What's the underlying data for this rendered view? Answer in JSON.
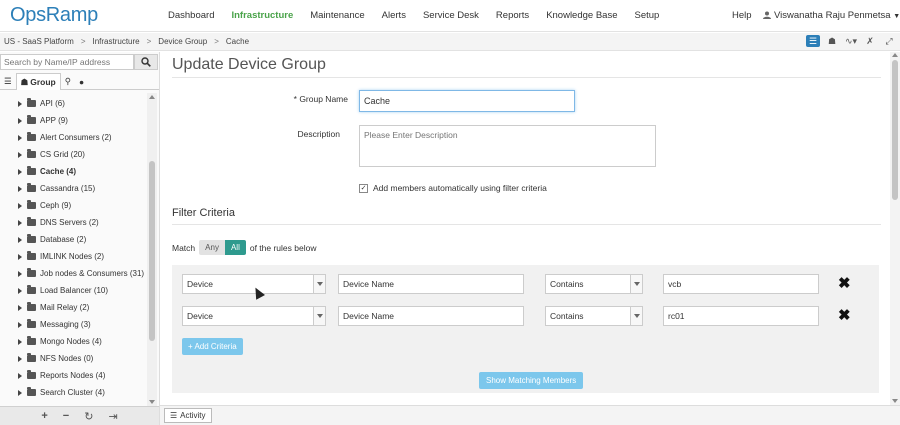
{
  "app": {
    "logo": "OpsRamp",
    "brand_color": "#2c7fb8",
    "active_color": "#4aa34a"
  },
  "nav": {
    "items": [
      "Dashboard",
      "Infrastructure",
      "Maintenance",
      "Alerts",
      "Service Desk",
      "Reports",
      "Knowledge Base",
      "Setup"
    ],
    "active": "Infrastructure",
    "help": "Help",
    "user": "Viswanatha Raju Penmetsa"
  },
  "breadcrumb": [
    "US - SaaS Platform",
    "Infrastructure",
    "Device Group",
    "Cache"
  ],
  "left": {
    "search_placeholder": "Search by Name/IP address",
    "group_tab": "Group",
    "tree": [
      "API (6)",
      "APP (9)",
      "Alert Consumers (2)",
      "CS Grid (20)",
      "Cache (4)",
      "Cassandra (15)",
      "Ceph (9)",
      "DNS Servers (2)",
      "Database (2)",
      "IMLINK Nodes (2)",
      "Job nodes & Consumers (31)",
      "Load Balancer (10)",
      "Mail Relay (2)",
      "Messaging (3)",
      "Mongo Nodes (4)",
      "NFS Nodes (0)",
      "Reports Nodes (4)",
      "Search Cluster (4)"
    ],
    "selected": "Cache (4)"
  },
  "form": {
    "title": "Update Device Group",
    "group_name_label": "* Group Name",
    "group_name_value": "Cache",
    "description_label": "Description",
    "description_placeholder": "Please Enter Description",
    "auto_members_label": "Add members automatically using filter criteria",
    "auto_members_checked": true
  },
  "filter": {
    "title": "Filter Criteria",
    "match_prefix": "Match",
    "match_options": [
      "Any",
      "All"
    ],
    "match_selected": "All",
    "match_suffix": "of the rules below",
    "rules": [
      {
        "entity": "Device",
        "field": "Device Name",
        "operator": "Contains",
        "value": "vcb"
      },
      {
        "entity": "Device",
        "field": "Device Name",
        "operator": "Contains",
        "value": "rc01"
      }
    ],
    "add_criteria": "+ Add Criteria",
    "show_matching": "Show Matching Members"
  },
  "bottom": {
    "activity": "Activity"
  }
}
